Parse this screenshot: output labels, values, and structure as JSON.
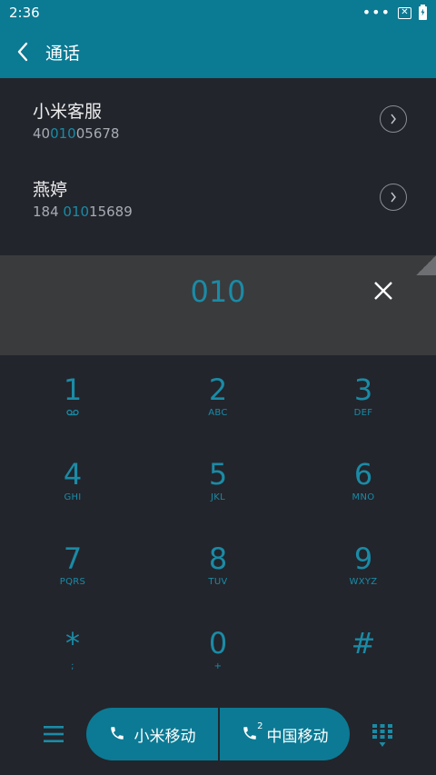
{
  "status": {
    "time": "2:36",
    "dots": "•••",
    "notice": "✕"
  },
  "appbar": {
    "title": "通话"
  },
  "contacts": [
    {
      "name": "小米客服",
      "num_pre": "40",
      "num_hl": "010",
      "num_post": "05678"
    },
    {
      "name": "燕婷",
      "num_pre": "184 ",
      "num_hl": "010",
      "num_post": "15689"
    }
  ],
  "input": {
    "digits": "010"
  },
  "keys": [
    {
      "digit": "1",
      "letters": ""
    },
    {
      "digit": "2",
      "letters": "ABC"
    },
    {
      "digit": "3",
      "letters": "DEF"
    },
    {
      "digit": "4",
      "letters": "GHI"
    },
    {
      "digit": "5",
      "letters": "JKL"
    },
    {
      "digit": "6",
      "letters": "MNO"
    },
    {
      "digit": "7",
      "letters": "PQRS"
    },
    {
      "digit": "8",
      "letters": "TUV"
    },
    {
      "digit": "9",
      "letters": "WXYZ"
    },
    {
      "digit": "*",
      "letters": ";"
    },
    {
      "digit": "0",
      "letters": "+"
    },
    {
      "digit": "#",
      "letters": ""
    }
  ],
  "call": {
    "sim1": "小米移动",
    "sim2": "中国移动",
    "sim2_index": "2"
  },
  "colors": {
    "accent": "#0b7a93",
    "digit": "#1a8ba6",
    "background": "#22252c",
    "panel": "#3a3b3d"
  }
}
